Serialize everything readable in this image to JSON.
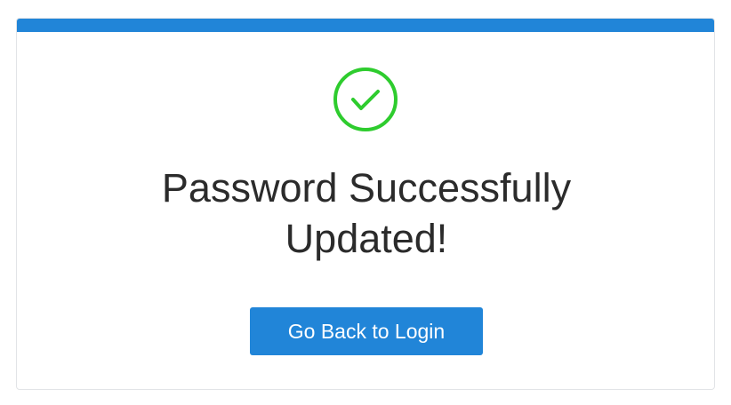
{
  "colors": {
    "accent": "#2185d8",
    "success": "#2ecc2e",
    "text": "#2b2b2b",
    "border": "#e2e4e7"
  },
  "success_icon": "check-circle-icon",
  "message": {
    "title": "Password Successfully Updated!"
  },
  "actions": {
    "back_label": "Go Back to Login"
  }
}
